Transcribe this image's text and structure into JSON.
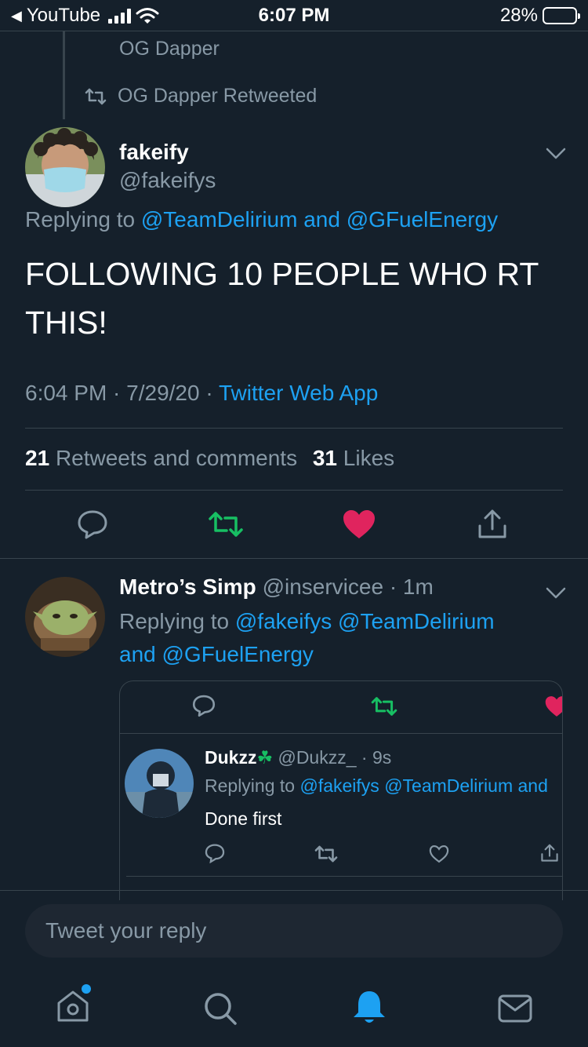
{
  "status_bar": {
    "back_app": "YouTube",
    "time": "6:07 PM",
    "battery_percent": "28%",
    "battery_level": 0.28
  },
  "context": {
    "parent_name": "OG Dapper",
    "retweet_label": "OG Dapper Retweeted"
  },
  "tweet": {
    "display_name": "fakeify",
    "handle": "@fakeifys",
    "replying_prefix": "Replying to",
    "replying_to_1": "@TeamDelirium",
    "replying_and": "and",
    "replying_to_2": "@GFuelEnergy",
    "text_line1": "FOLLOWING 10 PEOPLE WHO RT",
    "text_line2": "THIS!",
    "timestamp": "6:04 PM · 7/29/20 ·",
    "source": "Twitter Web App",
    "retweets_count": "21",
    "retweets_label": "Retweets and comments",
    "likes_count": "31",
    "likes_label": "Likes"
  },
  "reply": {
    "display_name": "Metro’s Simp",
    "handle_time": "@inservicee · 1m",
    "replying_prefix": "Replying to",
    "replying_to_1": "@fakeifys",
    "replying_to_2": "@TeamDelirium",
    "replying_and": "and",
    "replying_to_3": "@GFuelEnergy"
  },
  "quoted": {
    "display_name": "Dukzz",
    "emoji": "☘",
    "handle_time": "@Dukzz_ · 9s",
    "replying_prefix": "Replying to",
    "replying_to_1": "@fakeifys",
    "replying_to_2": "@TeamDelirium",
    "replying_tail": "and",
    "text": "Done first"
  },
  "composer": {
    "placeholder": "Tweet your reply"
  },
  "colors": {
    "background": "#15202b",
    "link": "#1da1f2",
    "retweet_green": "#17bf63",
    "like_red": "#e0245e",
    "muted": "#8899a6"
  },
  "tab_bar": {
    "icons": [
      "home-icon",
      "search-icon",
      "notifications-icon",
      "messages-icon"
    ]
  }
}
